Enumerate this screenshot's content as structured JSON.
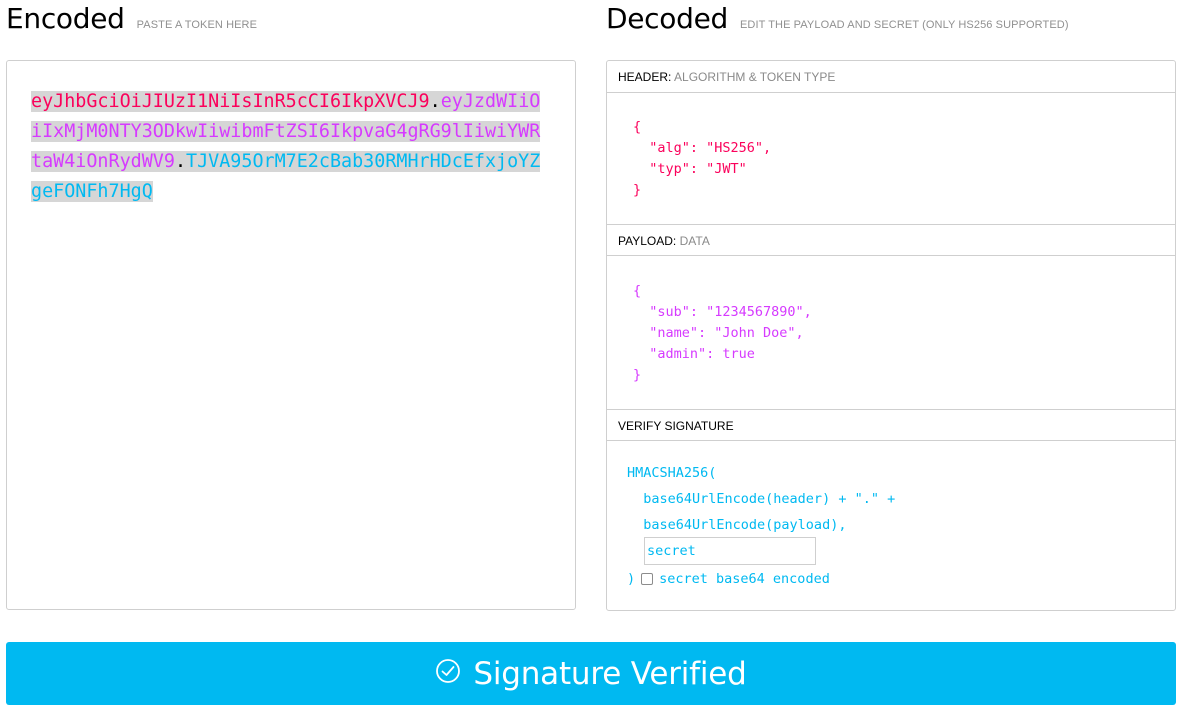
{
  "encoded": {
    "title": "Encoded",
    "subtitle": "PASTE A TOKEN HERE",
    "token": {
      "header": "eyJhbGciOiJIUzI1NiIsInR5cCI6IkpXVCJ9",
      "payload": "eyJzdWIiOiIxMjM0NTY3ODkwIiwibmFtZSI6IkpvaG4gRG9lIiwiYWRtaW4iOnRydWV9",
      "signature": "TJVA95OrM7E2cBab30RMHrHDcEfxjoYZgeFONFh7HgQ",
      "dot": "."
    }
  },
  "decoded": {
    "title": "Decoded",
    "subtitle": "EDIT THE PAYLOAD AND SECRET (ONLY HS256 SUPPORTED)",
    "header_section": {
      "label": "HEADER:",
      "sublabel": "ALGORITHM & TOKEN TYPE",
      "json": "{\n  \"alg\": \"HS256\",\n  \"typ\": \"JWT\"\n}"
    },
    "payload_section": {
      "label": "PAYLOAD:",
      "sublabel": "DATA",
      "json": "{\n  \"sub\": \"1234567890\",\n  \"name\": \"John Doe\",\n  \"admin\": true\n}"
    },
    "signature_section": {
      "label": "VERIFY SIGNATURE",
      "code": "HMACSHA256(\n  base64UrlEncode(header) + \".\" +\n  base64UrlEncode(payload),",
      "secret_value": "secret",
      "close_paren": ")",
      "checkbox_label": "secret base64 encoded",
      "checkbox_checked": false
    }
  },
  "status": {
    "label": "Signature Verified",
    "icon": "check-circle-icon",
    "color": "#00b9f1"
  },
  "colors": {
    "header": "#fb015b",
    "payload": "#d63aff",
    "signature": "#00b9f1"
  }
}
